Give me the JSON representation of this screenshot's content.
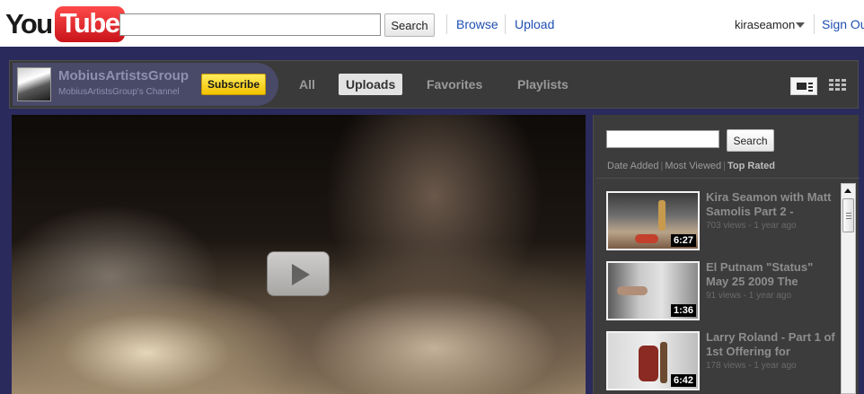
{
  "header": {
    "logo_you": "You",
    "logo_tube": "Tube",
    "search_value": "",
    "search_button": "Search",
    "browse": "Browse",
    "upload": "Upload",
    "username": "kiraseamon",
    "sign_out": "Sign Out"
  },
  "channel": {
    "name": "MobiusArtistsGroup",
    "subtitle": "MobiusArtistsGroup's Channel",
    "subscribe": "Subscribe",
    "tabs": [
      {
        "label": "All",
        "active": false
      },
      {
        "label": "Uploads",
        "active": true
      },
      {
        "label": "Favorites",
        "active": false
      },
      {
        "label": "Playlists",
        "active": false
      }
    ]
  },
  "panel": {
    "search_value": "",
    "search_button": "Search",
    "sort": [
      "Date Added",
      "Most Viewed",
      "Top Rated"
    ],
    "sort_active": "Top Rated",
    "videos": [
      {
        "title": "Kira Seamon with Matt Samolis Part 2 -",
        "meta": "703 views - 1 year ago",
        "duration": "6:27"
      },
      {
        "title": "El Putnam \"Status\" May 25 2009 The",
        "meta": "91 views - 1 year ago",
        "duration": "1:36"
      },
      {
        "title": "Larry Roland - Part 1 of 1st Offering for",
        "meta": "178 views - 1 year ago",
        "duration": "6:42"
      }
    ]
  },
  "colors": {
    "page_frame": "#2b2a5c",
    "link": "#1f4fb3",
    "subscribe": "#f2c200",
    "logo_red": "#c8141a"
  }
}
